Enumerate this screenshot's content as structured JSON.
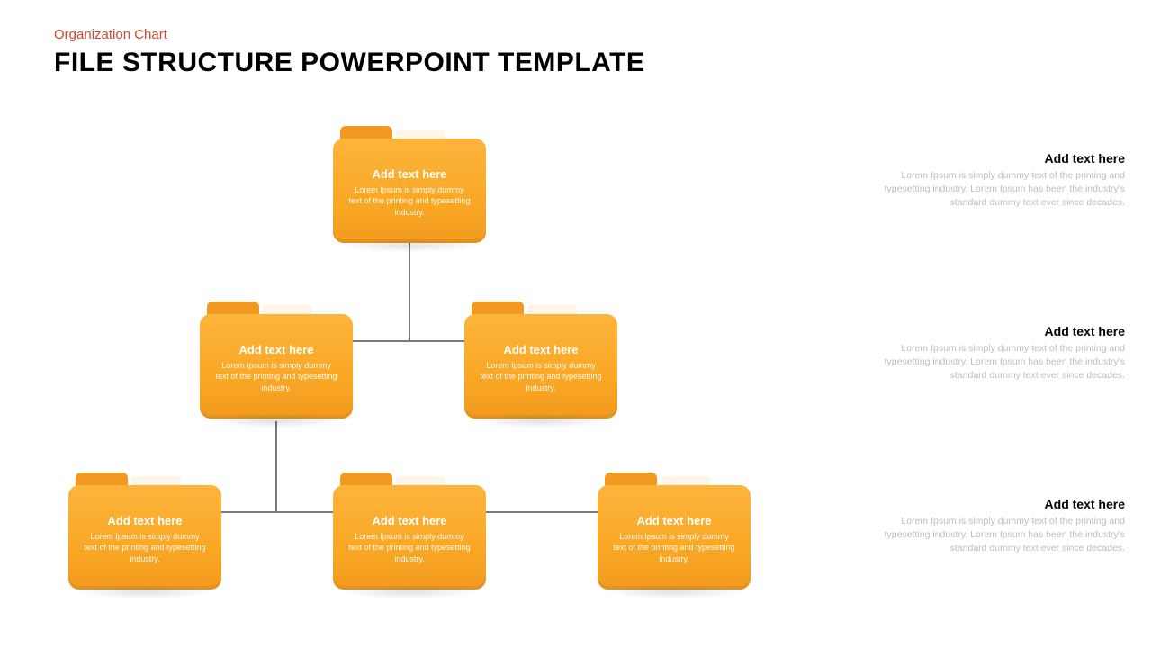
{
  "header": {
    "subtitle": "Organization Chart",
    "title": "FILE STRUCTURE POWERPOINT TEMPLATE"
  },
  "folders": {
    "root": {
      "title": "Add text here",
      "desc": "Lorem Ipsum is simply dummy text of the printing and typesetting industry."
    },
    "mid_l": {
      "title": "Add text here",
      "desc": "Lorem Ipsum is simply dummy text of the printing and typesetting industry."
    },
    "mid_r": {
      "title": "Add text here",
      "desc": "Lorem Ipsum is simply dummy text of the printing and typesetting industry."
    },
    "bot_1": {
      "title": "Add text here",
      "desc": "Lorem Ipsum is simply dummy text of the printing and typesetting industry."
    },
    "bot_2": {
      "title": "Add text here",
      "desc": "Lorem Ipsum is simply dummy text of the printing and typesetting industry."
    },
    "bot_3": {
      "title": "Add text here",
      "desc": "Lorem Ipsum is simply dummy text of the printing and typesetting industry."
    }
  },
  "info": {
    "row1": {
      "title": "Add text here",
      "desc": "Lorem Ipsum is simply dummy text of the printing and typesetting industry. Lorem Ipsum has been the industry's standard dummy text ever since decades."
    },
    "row2": {
      "title": "Add text here",
      "desc": "Lorem Ipsum is simply dummy text of the printing and typesetting industry. Lorem Ipsum has been the industry's standard dummy text ever since decades."
    },
    "row3": {
      "title": "Add text here",
      "desc": "Lorem Ipsum is simply dummy text of the printing and typesetting industry. Lorem Ipsum has been the industry's standard dummy text ever since decades."
    }
  },
  "colors": {
    "accent": "#d2492a",
    "folder": "#f9a825"
  }
}
